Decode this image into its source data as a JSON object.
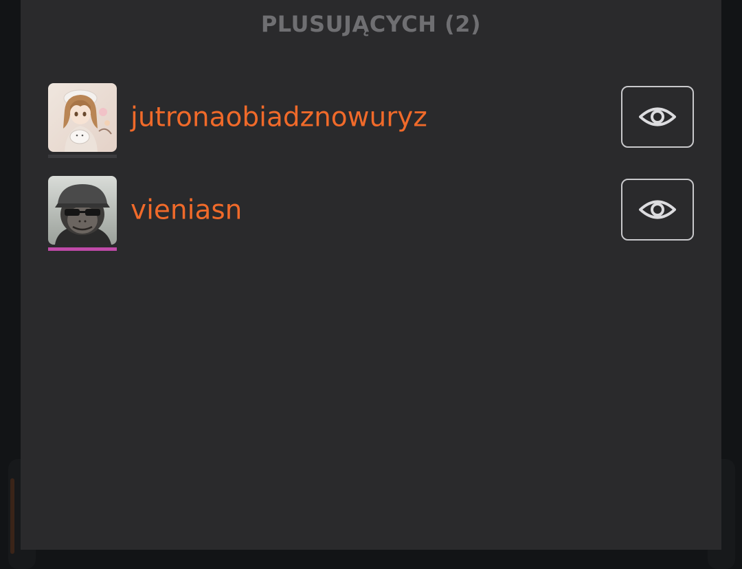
{
  "panel": {
    "title": "PLUSUJĄCYCH (2)"
  },
  "users": [
    {
      "name": "jutronaobiadznowuryz",
      "avatar": "anime-girl-avatar",
      "underline_color": "#3b3b3e",
      "action_icon": "eye-icon"
    },
    {
      "name": "vieniasn",
      "avatar": "monkey-with-cap-avatar",
      "underline_color": "#c04aa8",
      "action_icon": "eye-icon"
    }
  ],
  "colors": {
    "background": "#121416",
    "panel": "#2a2a2c",
    "title": "#6f6f72",
    "username": "#f06a2a",
    "button_border": "#c9c9cc"
  }
}
